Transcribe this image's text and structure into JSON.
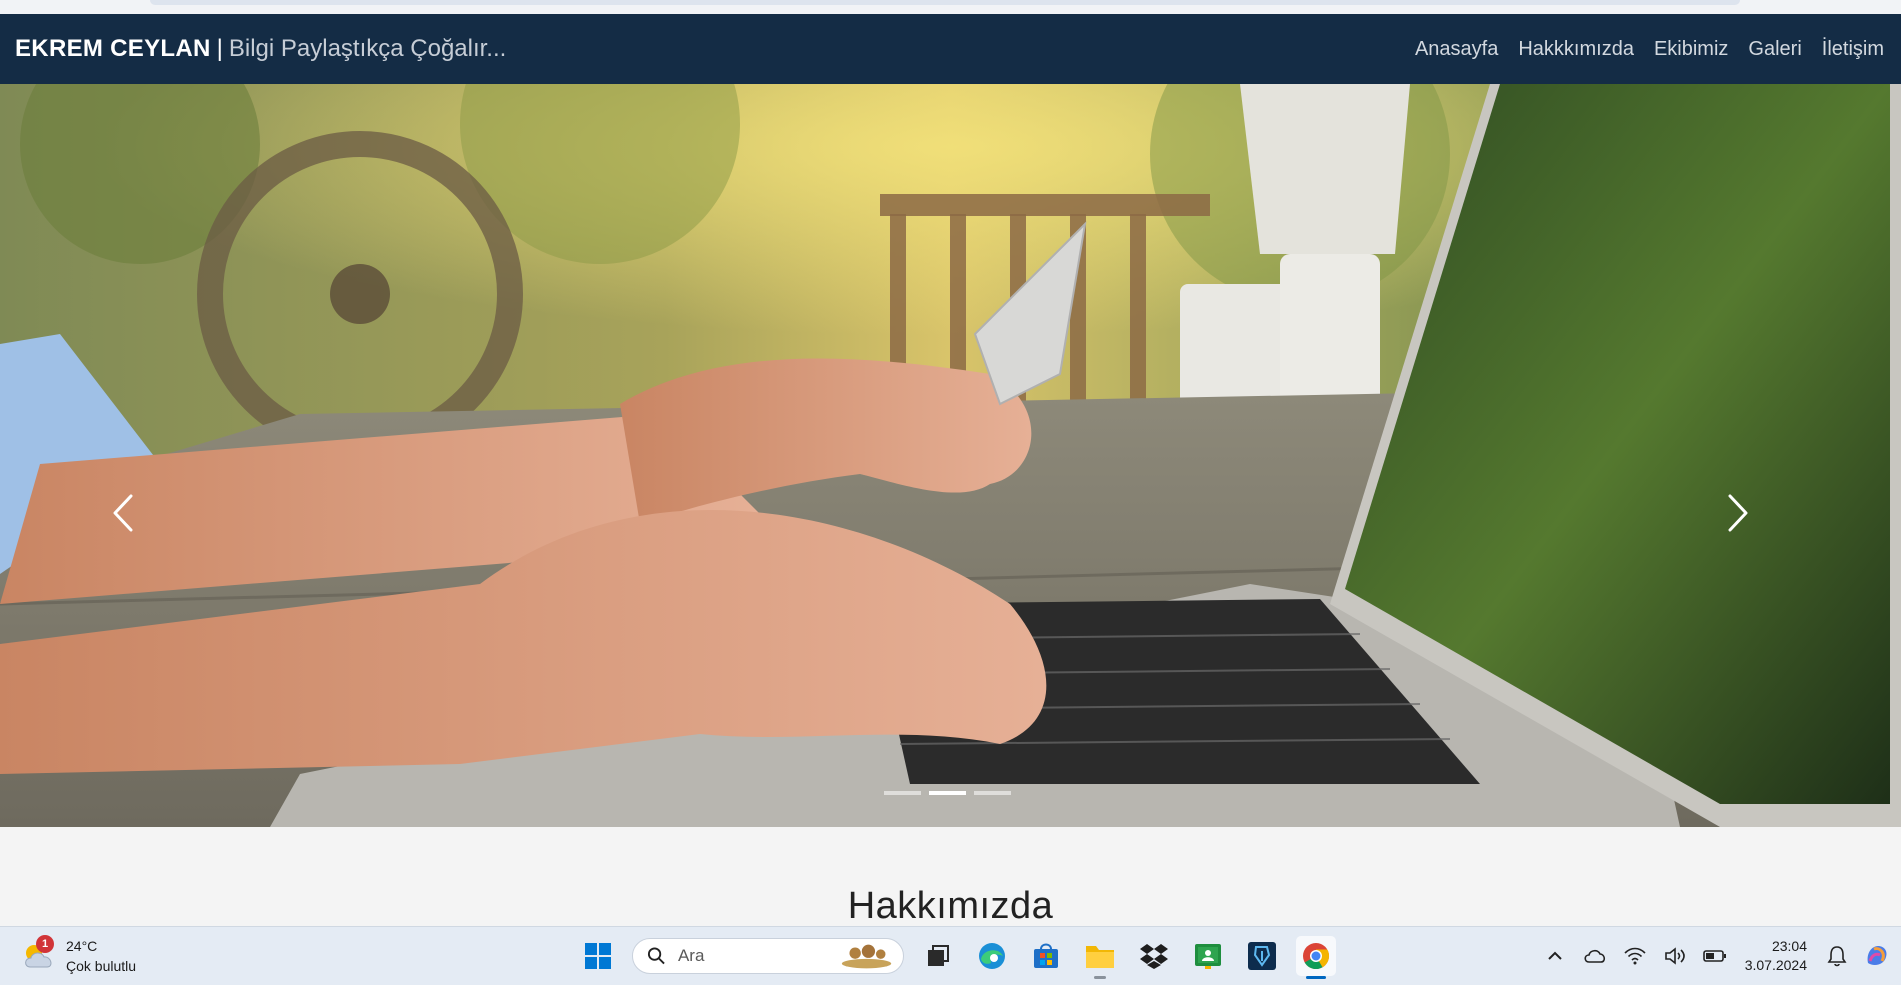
{
  "navbar": {
    "brand_name": "EKREM CEYLAN",
    "brand_separator": "|",
    "brand_tagline": "Bilgi Paylaştıkça Çoğalır...",
    "links": [
      "Anasayfa",
      "Hakkkımızda",
      "Ekibimiz",
      "Galeri",
      "İletişim"
    ]
  },
  "carousel": {
    "image_description": "hands typing on a laptop keyboard while holding a credit card",
    "prev_icon": "chevron-left-icon",
    "next_icon": "chevron-right-icon",
    "slide_count": 3,
    "active_slide": 2
  },
  "section": {
    "title": "Hakkımızda"
  },
  "taskbar": {
    "weather": {
      "badge": "1",
      "temperature": "24°C",
      "condition": "Çok bulutlu"
    },
    "search_placeholder": "Ara",
    "apps": [
      "start-icon",
      "task-view-icon",
      "edge-icon",
      "store-icon",
      "file-explorer-icon",
      "dropbox-icon",
      "classroom-icon",
      "app-icon",
      "chrome-icon"
    ],
    "clock": {
      "time": "23:04",
      "date": "3.07.2024"
    }
  },
  "colors": {
    "navbar_bg": "#142c45",
    "page_bg": "#f4f4f4",
    "taskbar_bg": "#e4ebf4",
    "accent": "#0067c0"
  }
}
